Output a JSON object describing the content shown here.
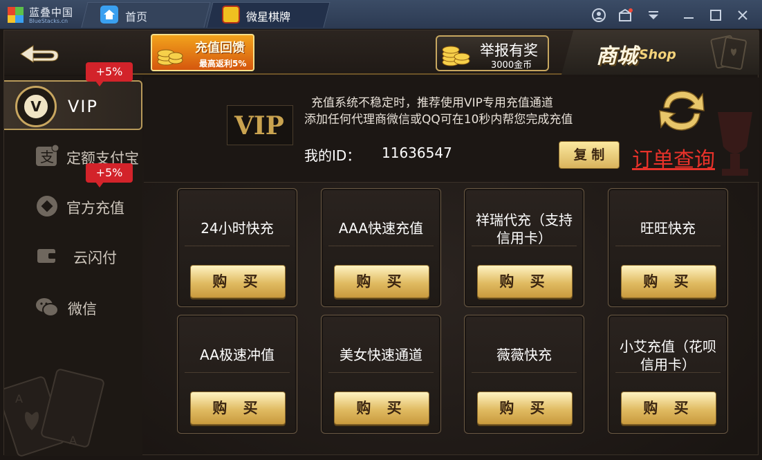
{
  "titlebar": {
    "app_name": "蓝叠中国",
    "app_sub": "BlueStacks.cn",
    "tabs": [
      {
        "label": "首页"
      },
      {
        "label": "微星棋牌"
      }
    ]
  },
  "topbar": {
    "promo": {
      "title": "充值回馈",
      "subtitle": "最高返利5%"
    },
    "report": {
      "title": "举报有奖",
      "subtitle": "3000金币"
    },
    "shop": {
      "cn": "商城",
      "en": "Shop"
    }
  },
  "sidebar": {
    "items": [
      {
        "label": "VIP",
        "tag": "+5%"
      },
      {
        "label": "定额支付宝"
      },
      {
        "label": "官方充值",
        "tag": "+5%"
      },
      {
        "label": "云闪付"
      },
      {
        "label": "微信"
      }
    ]
  },
  "info": {
    "vip_logo": "VIP",
    "notice_line1": "充值系统不稳定时，推荐使用VIP专用充值通道",
    "notice_line2": "添加任何代理商微信或QQ可在10秒内帮您完成充值",
    "my_id_label": "我的ID：",
    "my_id_value": "11636547",
    "copy_label": "复 制",
    "order_query_label": "订单查询"
  },
  "cards": [
    {
      "name": "24小时快充",
      "buy_label": "购 买"
    },
    {
      "name": "AAA快速充值",
      "buy_label": "购 买"
    },
    {
      "name": "祥瑞代充（支持",
      "name_line2": "信用卡）",
      "buy_label": "购 买"
    },
    {
      "name": "旺旺快充",
      "buy_label": "购 买"
    },
    {
      "name": "AA极速冲值",
      "buy_label": "购 买"
    },
    {
      "name": "美女快速通道",
      "buy_label": "购 买"
    },
    {
      "name": "薇薇快充",
      "buy_label": "购 买"
    },
    {
      "name": "小艾充值（花呗",
      "name_line2": "信用卡）",
      "buy_label": "购 买"
    }
  ],
  "colors": {
    "accent_gold": "#d9b35c",
    "order_query_red": "#e8322a",
    "tag_red": "#d3232a"
  }
}
